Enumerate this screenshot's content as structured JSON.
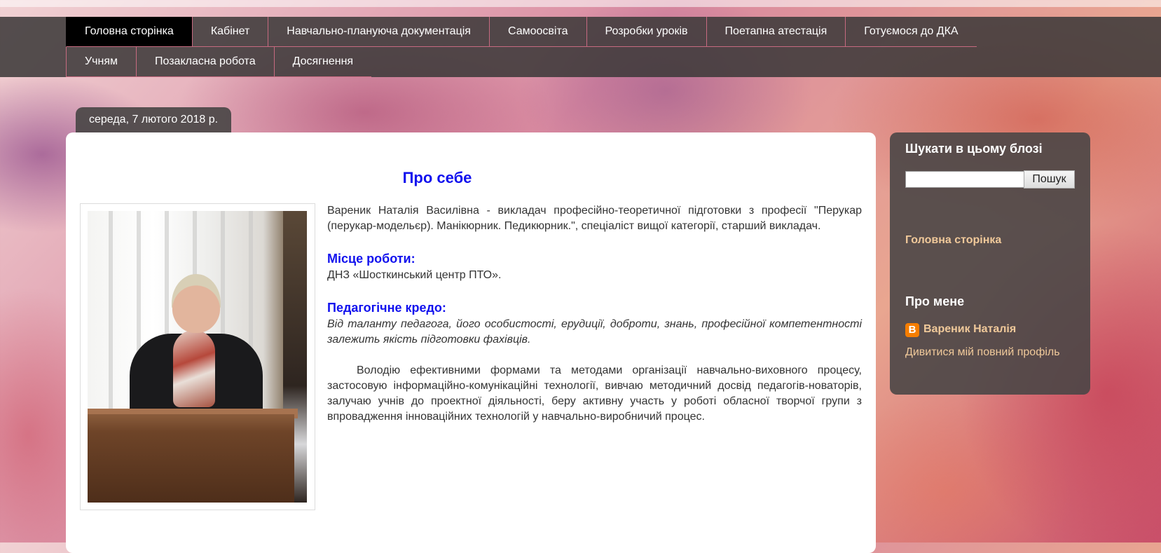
{
  "nav": {
    "row1": [
      {
        "label": "Головна сторінка",
        "active": true
      },
      {
        "label": "Кабінет"
      },
      {
        "label": "Навчально-плануюча документація"
      },
      {
        "label": "Самоосвіта"
      },
      {
        "label": "Розробки уроків"
      },
      {
        "label": "Поетапна атестація"
      },
      {
        "label": "Готуємося до ДКА"
      }
    ],
    "row2": [
      {
        "label": "Учням"
      },
      {
        "label": "Позакласна робота"
      },
      {
        "label": "Досягнення"
      }
    ]
  },
  "date": "середа, 7 лютого 2018 р.",
  "post": {
    "title": "Про себе",
    "intro": "Вареник Наталія Василівна - викладач професійно-теоретичної підготовки з професії \"Перукар (перукар-модельєр). Манікюрник. Педикюрник.\", спеціаліст вищої категорії, старший викладач.",
    "workplace_heading": "Місце роботи:",
    "workplace": "ДНЗ «Шосткинський центр ПТО».",
    "credo_heading": "Педагогічне кредо:",
    "credo": "Від таланту педагога, його особистості, ерудиції, доброти, знань, професійної компетентності залежить якість підготовки фахівців.",
    "paragraph": "Володію ефективними формами та методами організації навчально-виховного процесу, застосовую інформаційно-комунікаційні технології, вивчаю методичний досвід педагогів-новаторів, залучаю учнів до проектної діяльності, беру активну участь у роботі обласної творчої групи з впровадження інноваційних технологій у навчально-виробничий процес."
  },
  "sidebar": {
    "search_title": "Шукати в цьому блозі",
    "search_value": "",
    "search_button": "Пошук",
    "home_link": "Головна сторінка",
    "about_title": "Про мене",
    "author_name": "Вареник Наталія",
    "profile_link": "Дивитися мій повний профіль",
    "blogger_icon_glyph": "B"
  },
  "colors": {
    "heading_blue": "#1111ee",
    "sidebar_link": "#f0c99a",
    "nav_bg": "#3e3a3a",
    "nav_divider": "#c66a80"
  }
}
